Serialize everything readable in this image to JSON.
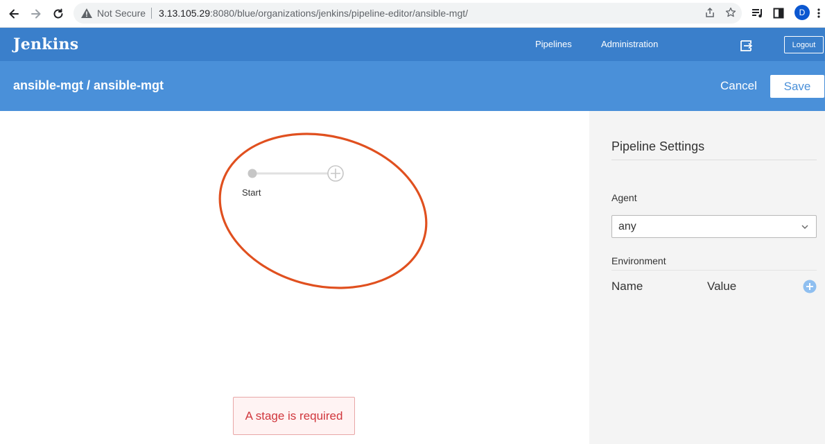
{
  "browser": {
    "security_label": "Not Secure",
    "url_host": "3.13.105.29",
    "url_path": ":8080/blue/organizations/jenkins/pipeline-editor/ansible-mgt/",
    "avatar_letter": "D"
  },
  "header": {
    "logo": "Jenkins",
    "nav": [
      "Pipelines",
      "Administration"
    ],
    "logout_label": "Logout"
  },
  "editor": {
    "title": "ansible-mgt / ansible-mgt",
    "cancel_label": "Cancel",
    "save_label": "Save"
  },
  "graph": {
    "start_label": "Start",
    "error_message": "A stage is required",
    "annotation_color": "#e0501f"
  },
  "settings": {
    "title": "Pipeline Settings",
    "agent_label": "Agent",
    "agent_value": "any",
    "environment_label": "Environment",
    "columns": [
      "Name",
      "Value"
    ]
  },
  "colors": {
    "topbar": "#3a7fcb",
    "subbar": "#4a90d9",
    "error_text": "#d0363c",
    "add_icon": "#8fbff0"
  }
}
